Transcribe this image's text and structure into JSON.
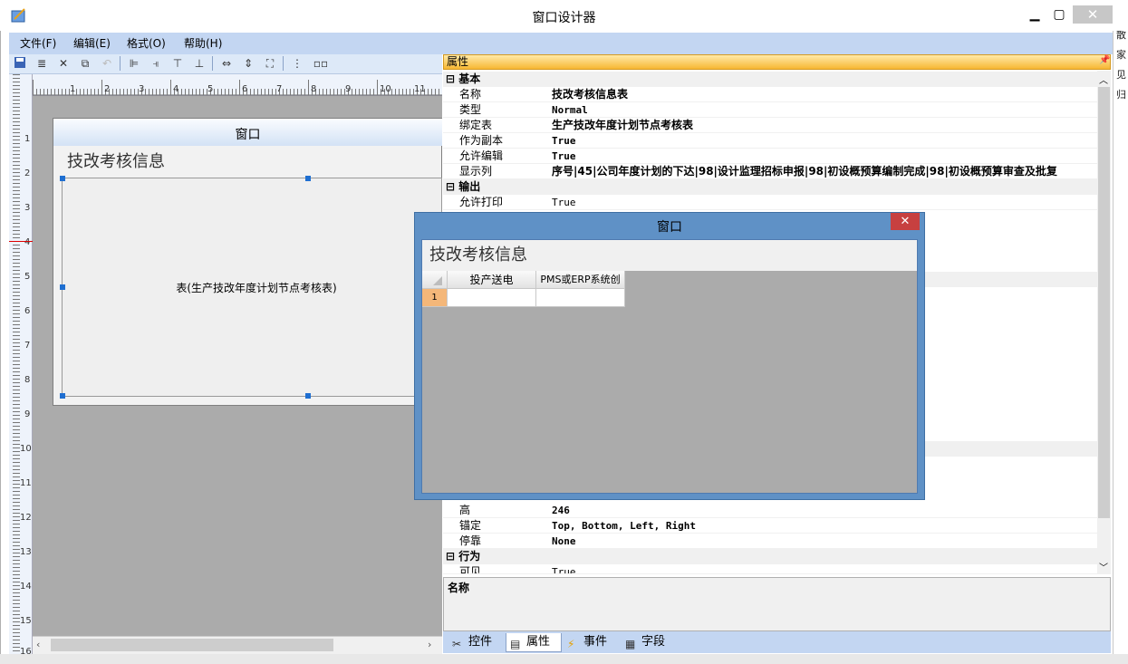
{
  "window": {
    "title": "窗口设计器"
  },
  "menu": [
    "文件(F)",
    "编辑(E)",
    "格式(O)",
    "帮助(H)"
  ],
  "ruler": {
    "h": [
      "1",
      "2",
      "3",
      "4",
      "5",
      "6",
      "7",
      "8",
      "9",
      "10",
      "11"
    ],
    "v": [
      "1",
      "2",
      "3",
      "4",
      "5",
      "6",
      "7",
      "8",
      "9",
      "10",
      "11",
      "12",
      "13",
      "14",
      "15",
      "16"
    ]
  },
  "design": {
    "form_title": "窗口",
    "header": "技改考核信息",
    "table_label": "表(生产技改年度计划节点考核表)"
  },
  "properties": {
    "title": "属性",
    "categories": {
      "basic": "基本",
      "output": "输出",
      "behavior": "行为"
    },
    "basic": [
      {
        "name": "名称",
        "value": "技改考核信息表"
      },
      {
        "name": "类型",
        "value": "Normal"
      },
      {
        "name": "绑定表",
        "value": "生产技改年度计划节点考核表"
      },
      {
        "name": "作为副本",
        "value": "True"
      },
      {
        "name": "允许编辑",
        "value": "True"
      },
      {
        "name": "显示列",
        "value": "序号|45|公司年度计划的下达|98|设计监理招标申报|98|初设概预算编制完成|98|初设概预算审查及批复"
      }
    ],
    "output": [
      {
        "name": "允许打印",
        "value": "True"
      }
    ],
    "layout": [
      {
        "name": "高",
        "value": "246"
      },
      {
        "name": "锚定",
        "value": "Top, Bottom, Left, Right"
      },
      {
        "name": "停靠",
        "value": "None"
      }
    ],
    "behavior": [
      {
        "name": "可见",
        "value": "True"
      }
    ],
    "description_label": "名称"
  },
  "tabs": [
    "控件",
    "属性",
    "事件",
    "字段"
  ],
  "preview": {
    "title": "窗口",
    "close": "✕",
    "header": "技改考核信息",
    "columns": [
      "投产送电",
      "PMS或ERP系统创"
    ],
    "row_numbers": [
      "1"
    ]
  },
  "background_text": {
    "right": [
      "散",
      "家",
      "见",
      "归"
    ]
  }
}
